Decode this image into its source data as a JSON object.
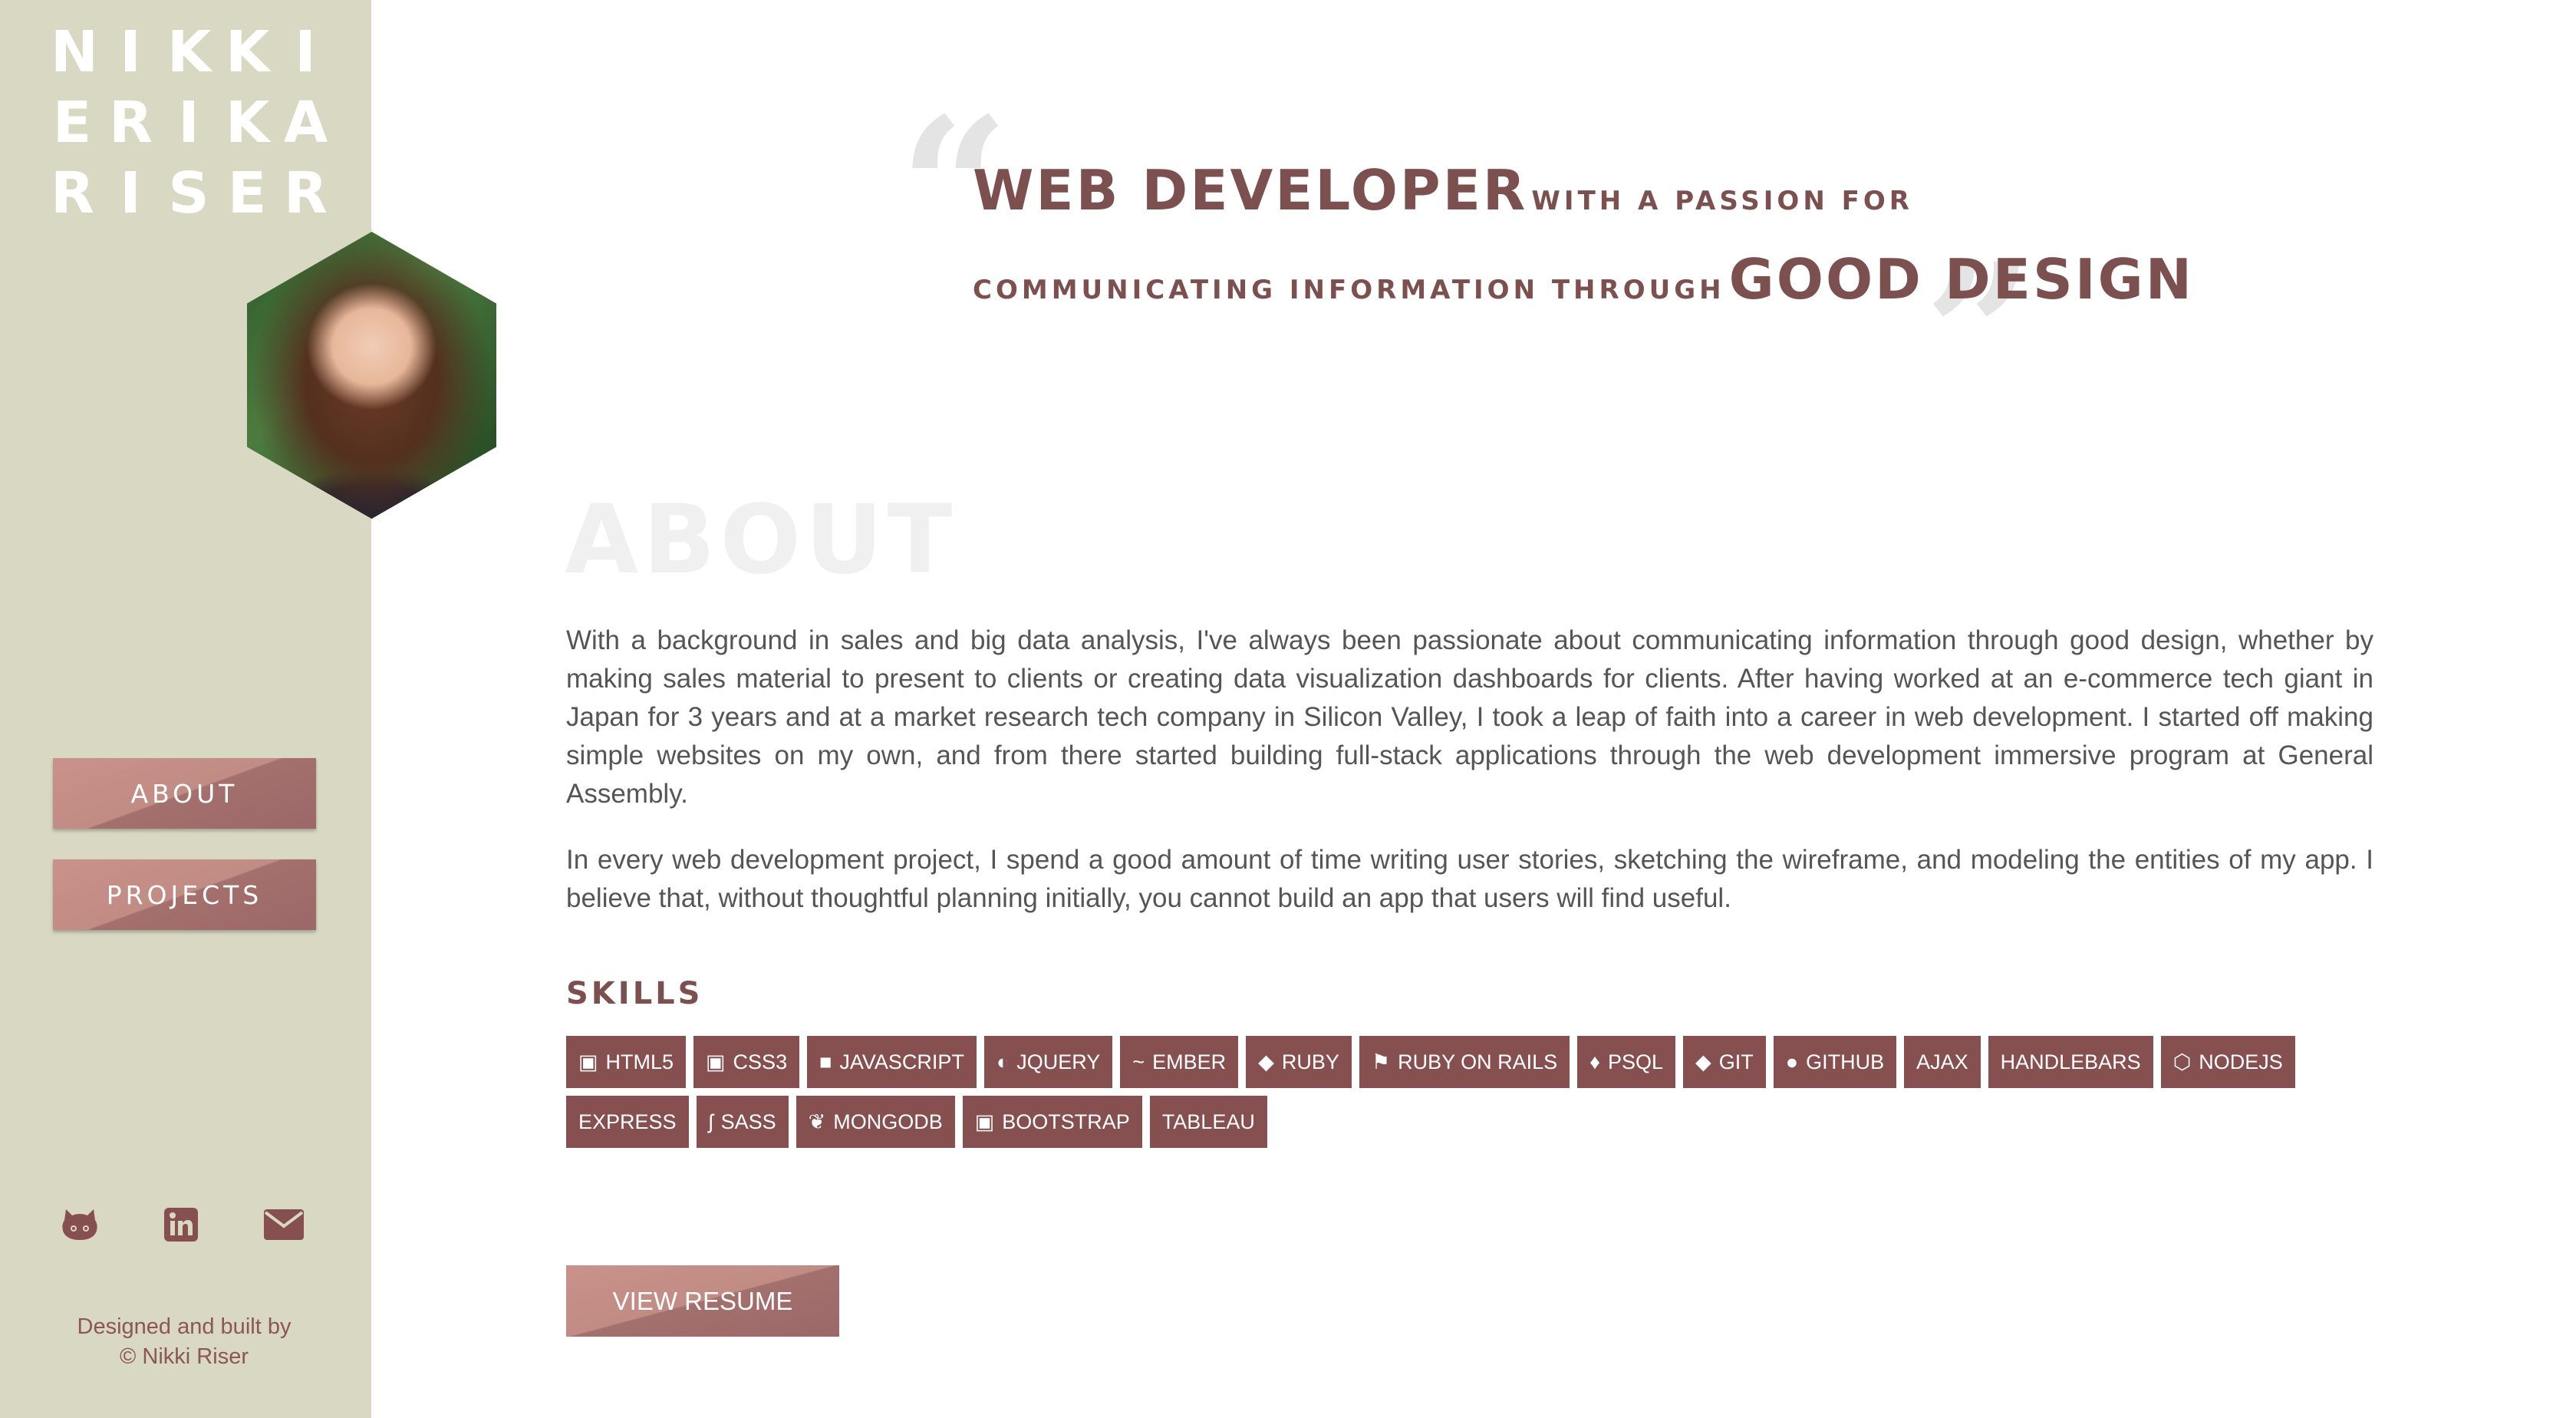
{
  "sidebar": {
    "name_lines": [
      [
        "N",
        "I",
        "K",
        "K",
        "I"
      ],
      [
        "E",
        "R",
        "I",
        "K",
        "A"
      ],
      [
        "R",
        "I",
        "S",
        "E",
        "R"
      ]
    ],
    "nav": {
      "about_label": "ABOUT",
      "projects_label": "PROJECTS"
    },
    "social_icons": [
      "github-icon",
      "linkedin-icon",
      "mail-icon"
    ],
    "credit_line1": "Designed and built by",
    "credit_line2": "© Nikki Riser"
  },
  "hero": {
    "open_quote": "“",
    "close_quote": "”",
    "line1_big": "WEB DEVELOPER",
    "line1_small": "WITH A PASSION FOR",
    "line2_small": "COMMUNICATING INFORMATION THROUGH",
    "line2_big": "GOOD DESIGN"
  },
  "about": {
    "title": "ABOUT",
    "paragraph1": "With a background in sales and big data analysis, I've always been passionate about communicating information through good design, whether by making sales material to present to clients or creating data visualization dashboards for clients. After having worked at an e-commerce tech giant in Japan for 3 years and at a market research tech company in Silicon Valley, I took a leap of faith into a career in web development. I started off making simple websites on my own, and from there started building full-stack applications through the web development immersive program at General Assembly.",
    "paragraph2": "In every web development project, I spend a good amount of time writing user stories, sketching the wireframe, and modeling the entities of my app. I believe that, without thoughtful planning initially, you cannot build an app that users will find useful."
  },
  "skills": {
    "title": "SKILLS",
    "items": [
      {
        "label": "HTML5",
        "icon": "html5-icon"
      },
      {
        "label": "CSS3",
        "icon": "css3-icon"
      },
      {
        "label": "JAVASCRIPT",
        "icon": "javascript-icon"
      },
      {
        "label": "JQUERY",
        "icon": "jquery-icon"
      },
      {
        "label": "EMBER",
        "icon": "ember-icon"
      },
      {
        "label": "RUBY",
        "icon": "ruby-icon"
      },
      {
        "label": "RUBY ON RAILS",
        "icon": "rails-icon"
      },
      {
        "label": "PSQL",
        "icon": "postgresql-icon"
      },
      {
        "label": "GIT",
        "icon": "git-icon"
      },
      {
        "label": "GITHUB",
        "icon": "github-icon"
      },
      {
        "label": "AJAX",
        "icon": ""
      },
      {
        "label": "HANDLEBARS",
        "icon": ""
      },
      {
        "label": "NODEJS",
        "icon": "nodejs-icon"
      },
      {
        "label": "EXPRESS",
        "icon": ""
      },
      {
        "label": "SASS",
        "icon": "sass-icon"
      },
      {
        "label": "MONGODB",
        "icon": "mongodb-icon"
      },
      {
        "label": "BOOTSTRAP",
        "icon": "bootstrap-icon"
      },
      {
        "label": "TABLEAU",
        "icon": ""
      }
    ]
  },
  "resume": {
    "label": "VIEW RESUME"
  },
  "colors": {
    "sidebar_bg": "#d9d9c3",
    "accent": "#875050",
    "button_light": "#c18c84",
    "button_dark": "#9c6768"
  }
}
